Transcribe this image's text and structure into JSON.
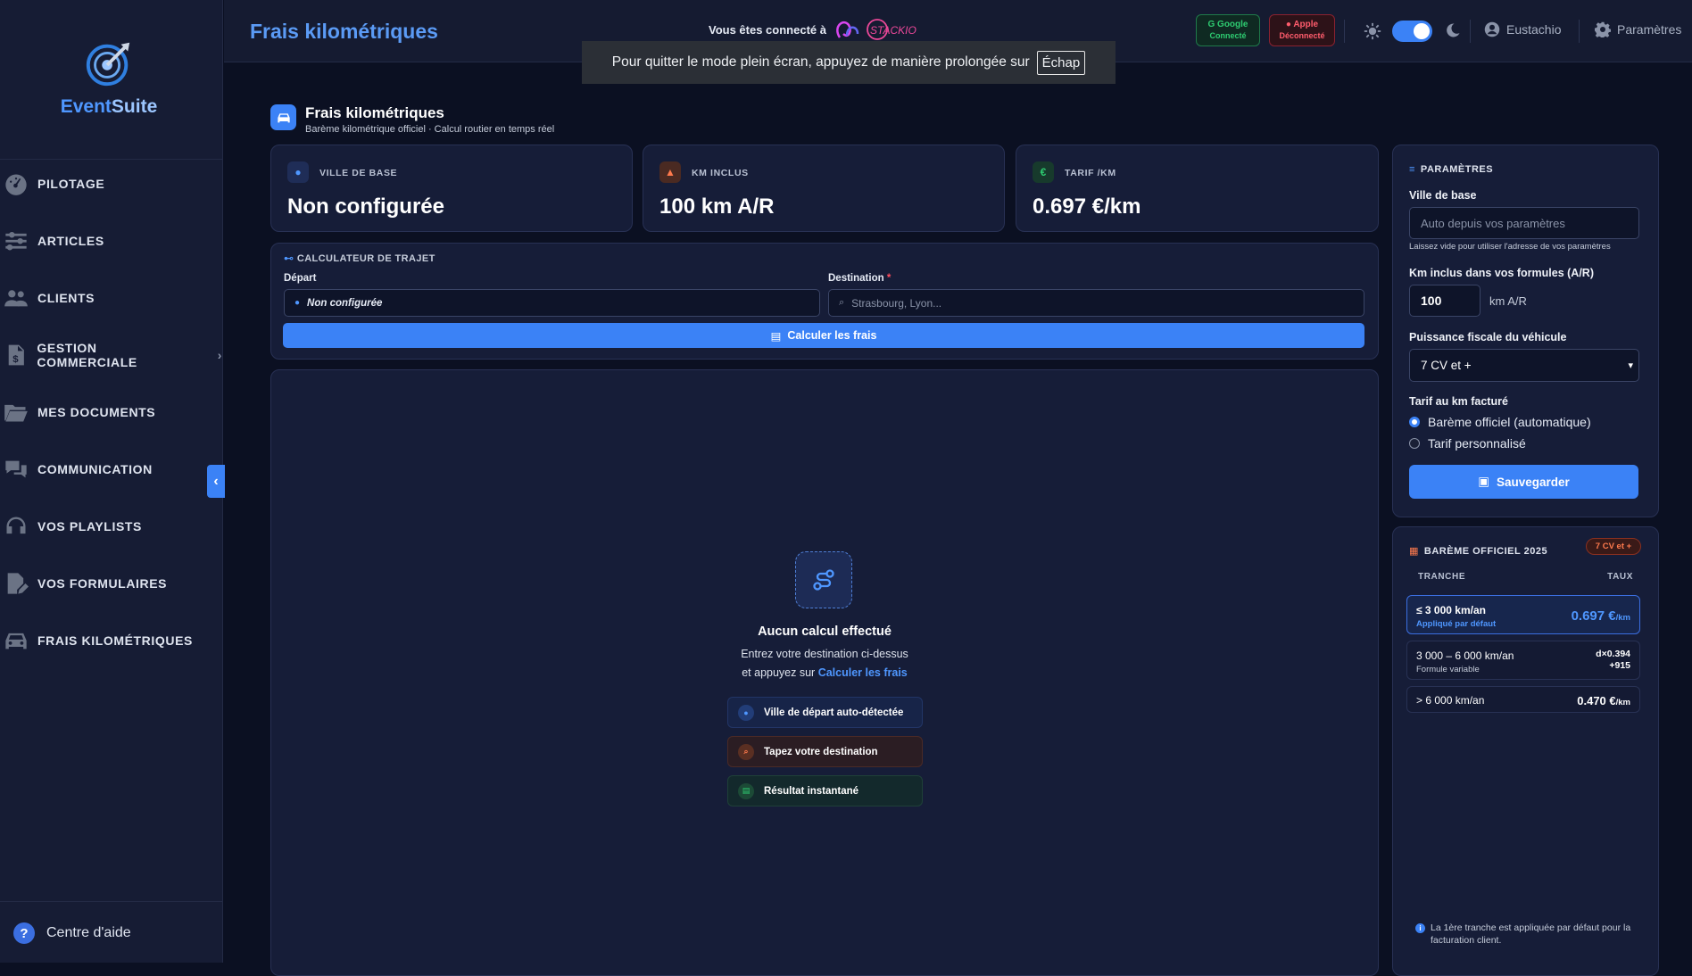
{
  "sidebar": {
    "brand_a": "Event",
    "brand_b": "Suite",
    "items": [
      {
        "label": "PILOTAGE"
      },
      {
        "label": "ARTICLES"
      },
      {
        "label": "CLIENTS"
      },
      {
        "label": "GESTION COMMERCIALE"
      },
      {
        "label": "MES DOCUMENTS"
      },
      {
        "label": "COMMUNICATION"
      },
      {
        "label": "VOS PLAYLISTS"
      },
      {
        "label": "VOS FORMULAIRES"
      },
      {
        "label": "FRAIS KILOMÉTRIQUES"
      }
    ],
    "help_label": "Centre d'aide"
  },
  "topbar": {
    "title": "Frais kilométriques",
    "connected_text": "Vous êtes connecté à",
    "partner_logo_text": "STACKIO",
    "google": {
      "name": "Google",
      "status": "Connecté"
    },
    "apple": {
      "name": "Apple",
      "status": "Déconnecté"
    },
    "user_name": "Eustachio",
    "settings_label": "Paramètres"
  },
  "fullscreen_toast": {
    "text": "Pour quitter le mode plein écran, appuyez de manière prolongée sur",
    "key": "Échap"
  },
  "page_header": {
    "title": "Frais kilométriques",
    "subtitle": "Barème kilométrique officiel · Calcul routier en temps réel"
  },
  "stats": [
    {
      "label": "VILLE DE BASE",
      "value": "Non configurée"
    },
    {
      "label": "KM INCLUS",
      "value": "100 km A/R"
    },
    {
      "label": "TARIF /KM",
      "value": "0.697 €/km"
    }
  ],
  "calculator": {
    "title": "CALCULATEUR DE TRAJET",
    "depart_label": "Départ",
    "depart_value": "Non configurée",
    "destination_label": "Destination",
    "destination_required": "*",
    "destination_placeholder": "Strasbourg, Lyon...",
    "button_label": "Calculer les frais"
  },
  "empty_state": {
    "title": "Aucun calcul effectué",
    "line1": "Entrez votre destination ci-dessus",
    "line2_prefix": "et appuyez sur",
    "line2_link": "Calculer les frais",
    "steps": [
      {
        "label": "Ville de départ auto-détectée"
      },
      {
        "label": "Tapez votre destination"
      },
      {
        "label": "Résultat instantané"
      }
    ]
  },
  "params": {
    "title": "PARAMÈTRES",
    "base_city_label": "Ville de base",
    "base_city_placeholder": "Auto depuis vos paramètres",
    "base_city_hint": "Laissez vide pour utiliser l'adresse de vos paramètres",
    "km_label": "Km inclus dans vos formules (A/R)",
    "km_value": "100",
    "km_unit": "km A/R",
    "power_label": "Puissance fiscale du véhicule",
    "power_value": "7 CV et +",
    "rate_label": "Tarif au km facturé",
    "rate_options": [
      {
        "label": "Barème officiel (automatique)",
        "selected": true
      },
      {
        "label": "Tarif personnalisé",
        "selected": false
      }
    ],
    "save_label": "Sauvegarder"
  },
  "bareme": {
    "title": "BARÈME OFFICIEL 2025",
    "badge": "7 CV et +",
    "col_tranche": "TRANCHE",
    "col_taux": "TAUX",
    "rows": [
      {
        "tranche": "≤ 3 000 km/an",
        "sub": "Appliqué par défaut",
        "rate": "0.697 €",
        "rate_unit": "/km"
      },
      {
        "tranche": "3 000 – 6 000 km/an",
        "sub": "Formule variable",
        "rate": "d×0.394",
        "rate2": "+915"
      },
      {
        "tranche": "> 6 000 km/an",
        "rate": "0.470 €",
        "rate_unit": "/km"
      }
    ],
    "note": "La 1ère tranche est appliquée par défaut pour la facturation client."
  },
  "colors": {
    "accent": "#3b82f6",
    "bg": "#0b1022",
    "sidebar": "#161c34",
    "card": "#161d38"
  }
}
